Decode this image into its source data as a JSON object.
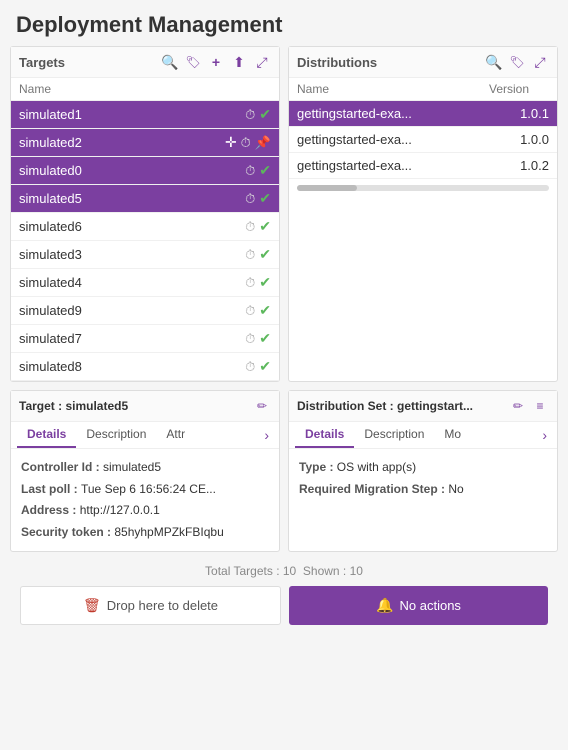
{
  "page": {
    "title": "Deployment Management"
  },
  "targets_panel": {
    "title": "Targets",
    "icons": [
      "search",
      "tag",
      "add",
      "upload",
      "expand"
    ],
    "columns": [
      "Name",
      "",
      ""
    ],
    "rows": [
      {
        "name": "simulated1",
        "selected": "purple",
        "has_move": false
      },
      {
        "name": "simulated2",
        "selected": "purple",
        "has_move": true
      },
      {
        "name": "simulated0",
        "selected": "purple",
        "has_move": false
      },
      {
        "name": "simulated5",
        "selected": "purple",
        "has_move": false
      },
      {
        "name": "simulated6",
        "selected": "none",
        "has_move": false
      },
      {
        "name": "simulated3",
        "selected": "none",
        "has_move": false
      },
      {
        "name": "simulated4",
        "selected": "none",
        "has_move": false
      },
      {
        "name": "simulated9",
        "selected": "none",
        "has_move": false
      },
      {
        "name": "simulated7",
        "selected": "none",
        "has_move": false
      },
      {
        "name": "simulated8",
        "selected": "none",
        "has_move": false
      }
    ]
  },
  "distributions_panel": {
    "title": "Distributions",
    "icons": [
      "search",
      "tag",
      "expand"
    ],
    "columns": [
      "Name",
      "Version"
    ],
    "rows": [
      {
        "name": "gettingstarted-exa...",
        "version": "1.0.1",
        "selected": true
      },
      {
        "name": "gettingstarted-exa...",
        "version": "1.0.0",
        "selected": false
      },
      {
        "name": "gettingstarted-exa...",
        "version": "1.0.2",
        "selected": false
      }
    ]
  },
  "target_detail": {
    "label": "Target : ",
    "name": "simulated5",
    "tabs": [
      "Details",
      "Description",
      "Attr"
    ],
    "fields": {
      "controller_id_label": "Controller Id : ",
      "controller_id_value": "simulated5",
      "last_poll_label": "Last poll : ",
      "last_poll_value": "Tue Sep 6 16:56:24 CE...",
      "address_label": "Address : ",
      "address_value": "http://127.0.0.1",
      "security_token_label": "Security token : ",
      "security_token_value": "85hyhpMPZkFBIqbu"
    }
  },
  "distribution_detail": {
    "label": "Distribution Set : ",
    "name": "gettingstart...",
    "tabs": [
      "Details",
      "Description",
      "Mo"
    ],
    "fields": {
      "type_label": "Type : ",
      "type_value": "OS with app(s)",
      "migration_label": "Required Migration Step : ",
      "migration_value": "No"
    }
  },
  "footer": {
    "total_label": "Total Targets : 10",
    "shown_label": "Shown : 10",
    "delete_button": "Drop here to delete",
    "actions_button": "No actions"
  }
}
